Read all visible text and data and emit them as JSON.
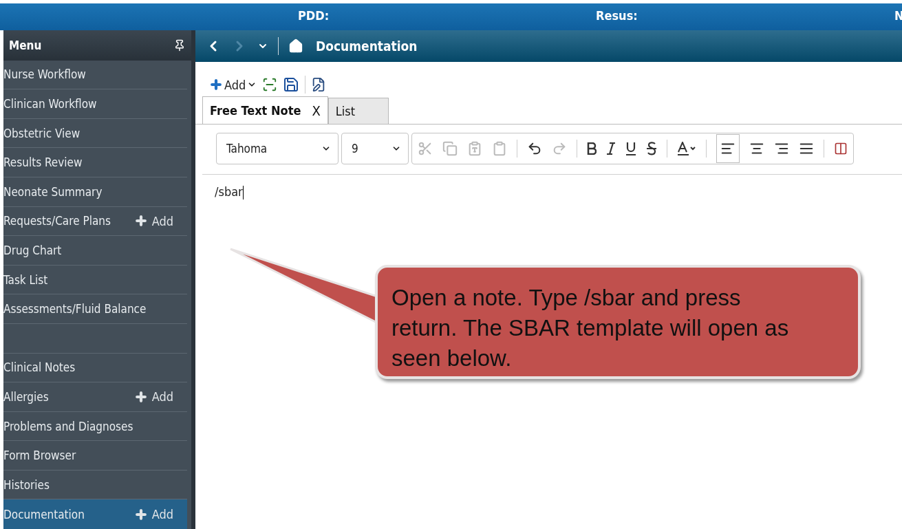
{
  "header": {
    "fields": [
      "PDD:",
      "Resus:",
      "N"
    ]
  },
  "menu": {
    "title": "Menu",
    "items": [
      {
        "label": "Nurse Workflow",
        "selected": false
      },
      {
        "label": "Clinican Workflow",
        "selected": false
      },
      {
        "label": "Obstetric View",
        "selected": false
      },
      {
        "label": "Results Review",
        "selected": false
      },
      {
        "label": "Neonate Summary",
        "selected": false
      },
      {
        "label": "Requests/Care Plans",
        "add": "Add",
        "selected": false
      },
      {
        "label": "Drug Chart",
        "selected": false
      },
      {
        "label": "Task List",
        "selected": false
      },
      {
        "label": "Assessments/Fluid Balance",
        "selected": false
      },
      {
        "selected": false
      },
      {
        "label": "Clinical Notes",
        "selected": false
      },
      {
        "label": "Allergies",
        "add": "Add",
        "selected": false
      },
      {
        "label": "Problems and Diagnoses",
        "selected": false
      },
      {
        "label": "Form Browser",
        "selected": false
      },
      {
        "label": "Histories",
        "selected": false
      },
      {
        "label": "Documentation",
        "add": "Add",
        "selected": true
      }
    ]
  },
  "nav": {
    "title": "Documentation"
  },
  "toolbar": {
    "add": "Add"
  },
  "tabs": [
    {
      "label": "Free Text Note",
      "selected": true,
      "close": "X"
    },
    {
      "label": "List",
      "selected": false
    }
  ],
  "editor": {
    "font": "Tahoma",
    "size": "9",
    "text": "/sbar"
  },
  "callout": {
    "text": "Open a note. Type /sbar and press return. The SBAR template will open as seen below."
  }
}
